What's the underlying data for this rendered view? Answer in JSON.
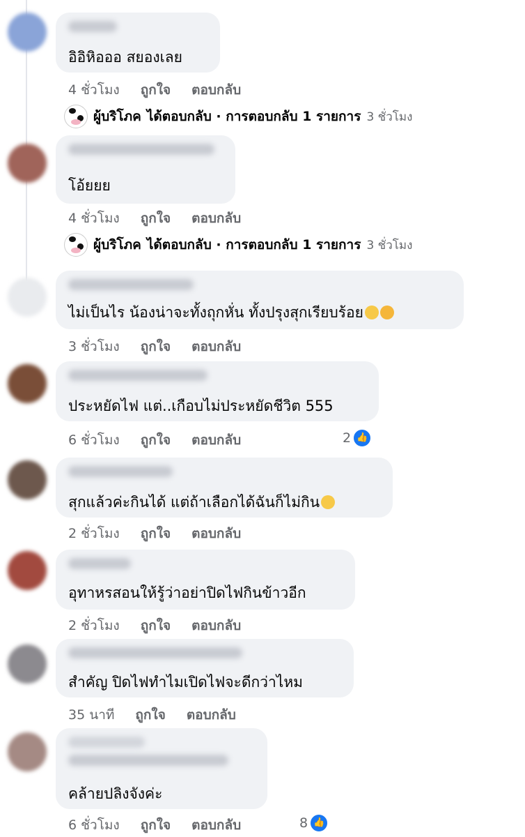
{
  "actions": {
    "like": "ถูกใจ",
    "reply": "ตอบกลับ"
  },
  "reply_summary": {
    "author": "ผู้บริโภค",
    "text": "ได้ตอบกลับ · การตอบกลับ 1 รายการ",
    "time": "3 ชั่วโมง"
  },
  "comments": [
    {
      "text": "อิอิหิอออ สยองเลย",
      "time": "4 ชั่วโมง"
    },
    {
      "text": "โอ้ยยย",
      "time": "4 ชั่วโมง"
    },
    {
      "text": "ไม่เป็นไร น้องน่าจะทั้งถุกหั่น ทั้งปรุงสุกเรียบร้อย",
      "time": "3 ชั่วโมง",
      "emoji": [
        "crying-face",
        "loudly-crying-face"
      ]
    },
    {
      "text": "ประหยัดไฟ แต่..เกือบไม่ประหยัดชีวิต 555",
      "time": "6 ชั่วโมง",
      "reaction_count": "2"
    },
    {
      "text": "สุกแล้วค่ะกินได้ แต่ถ้าเลือกได้ฉันก็ไม่กิน",
      "time": "2 ชั่วโมง",
      "emoji": [
        "sweat-smile-face"
      ]
    },
    {
      "text": "อุทาหรสอนให้รู้ว่าอย่าปิดไฟกินข้าวอีก",
      "time": "2 ชั่วโมง"
    },
    {
      "text": "สำคัญ ปิดไฟทำไมเปิดไฟจะดีกว่าไหม",
      "time": "35 นาที"
    },
    {
      "text": "คล้ายปลิงจังค่ะ",
      "time": "6 ชั่วโมง",
      "reaction_count": "8"
    }
  ],
  "colors": {
    "bubble": "#f0f2f5",
    "secondary_text": "#65676b",
    "like_blue": "#1877f2"
  }
}
